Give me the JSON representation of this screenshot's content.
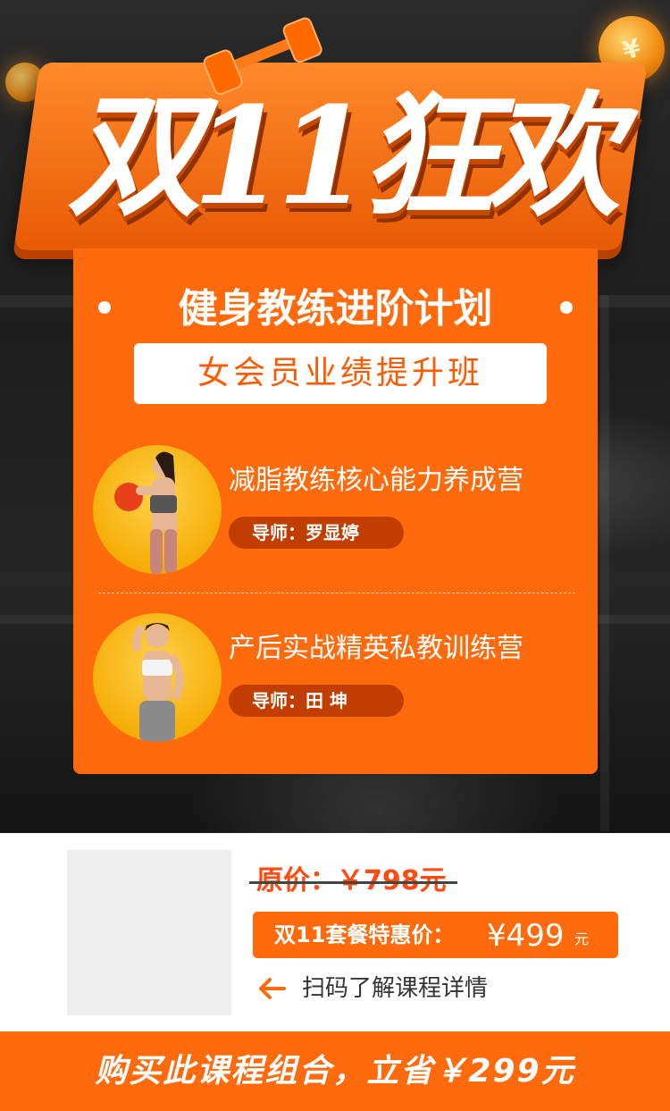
{
  "hero": {
    "title": "双11狂欢",
    "coin_symbol": "¥"
  },
  "card": {
    "headline": "健身教练进阶计划",
    "subtitle": "女会员业绩提升班",
    "courses": [
      {
        "title": "减脂教练核心能力养成营",
        "tutor": "导师：罗显婷"
      },
      {
        "title": "产后实战精英私教训练营",
        "tutor": "导师：田 坤"
      }
    ]
  },
  "pricing": {
    "original": "原价：￥798元",
    "deal_label": "双11套餐特惠价：",
    "deal_price": "¥499",
    "deal_unit": "元",
    "scan_hint": "扫码了解课程详情"
  },
  "footer": {
    "cta": "购买此课程组合，立省￥299元"
  },
  "colors": {
    "accent": "#ff6a0c",
    "tutor_pill": "#c23e00",
    "hero_bg": "#1d1d1d"
  }
}
